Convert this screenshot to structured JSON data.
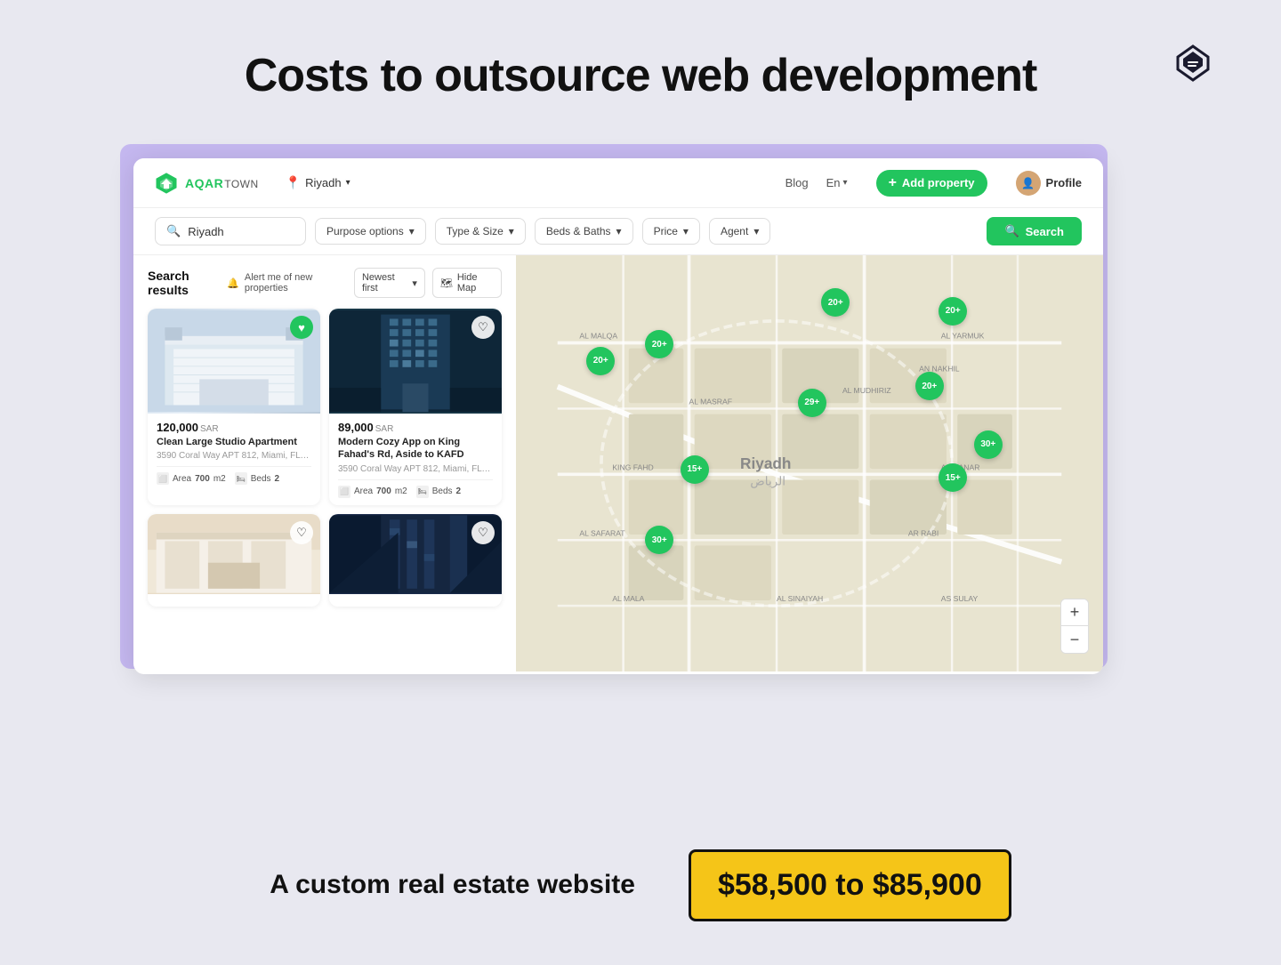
{
  "page": {
    "title": "Costs to outsource web development",
    "bg_color": "#e8e8f0"
  },
  "brand": {
    "name": "AQAR",
    "suffix": "TOWN",
    "accent_color": "#22c55e"
  },
  "navbar": {
    "location": "Riyadh",
    "blog_label": "Blog",
    "lang_label": "En",
    "add_property_label": "Add property",
    "profile_label": "Profile"
  },
  "search": {
    "placeholder": "Riyadh",
    "purpose_label": "Purpose options",
    "type_label": "Type & Size",
    "beds_label": "Beds & Baths",
    "price_label": "Price",
    "agent_label": "Agent",
    "button_label": "Search"
  },
  "results": {
    "title": "Search results",
    "alert_label": "Alert me of new properties",
    "sort_label": "Newest first",
    "hide_map_label": "Hide Map"
  },
  "properties": [
    {
      "id": 1,
      "price": "120,000",
      "currency": "SAR",
      "name": "Clean Large Studio Apartment",
      "address": "3590 Coral Way APT 812, Miami, FL 33...",
      "area": "700",
      "area_unit": "m2",
      "beds": "2",
      "favorited": true,
      "img_color": "#c8d8e8"
    },
    {
      "id": 2,
      "price": "89,000",
      "currency": "SAR",
      "name": "Modern Cozy App on King Fahad's Rd, Aside to KAFD",
      "address": "3590 Coral Way APT 812, Miami, FL 33...",
      "area": "700",
      "area_unit": "m2",
      "beds": "2",
      "favorited": false,
      "img_color": "#1a3a4a"
    },
    {
      "id": 3,
      "price": "",
      "currency": "",
      "name": "",
      "address": "",
      "area": "",
      "area_unit": "",
      "beds": "",
      "favorited": false,
      "img_color": "#e8dcc8"
    },
    {
      "id": 4,
      "price": "",
      "currency": "",
      "name": "",
      "address": "",
      "area": "",
      "area_unit": "",
      "beds": "",
      "favorited": false,
      "img_color": "#1a2a4a"
    }
  ],
  "map": {
    "clusters": [
      {
        "label": "20+",
        "top": "18%",
        "left": "22%"
      },
      {
        "label": "29+",
        "top": "32%",
        "left": "48%"
      },
      {
        "label": "20+",
        "top": "28%",
        "left": "68%"
      },
      {
        "label": "20+",
        "top": "10%",
        "left": "72%"
      },
      {
        "label": "20+",
        "top": "22%",
        "left": "12%"
      },
      {
        "label": "15+",
        "top": "48%",
        "left": "28%"
      },
      {
        "label": "15+",
        "top": "50%",
        "left": "72%"
      },
      {
        "label": "30+",
        "top": "42%",
        "left": "78%"
      },
      {
        "label": "30+",
        "top": "65%",
        "left": "22%"
      },
      {
        "label": "20+",
        "top": "8%",
        "left": "52%"
      }
    ],
    "zoom_in_label": "+",
    "zoom_out_label": "−",
    "city_label": "Riyadh"
  },
  "bottom": {
    "label": "A custom real estate website",
    "price_range": "$58,500 to $85,900"
  }
}
